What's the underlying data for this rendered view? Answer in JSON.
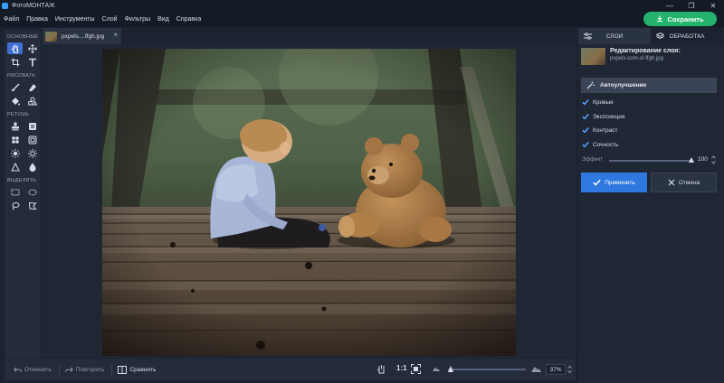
{
  "window": {
    "title": "ФотоМОНТАЖ",
    "controls": [
      "—",
      "❐",
      "✕"
    ]
  },
  "menu": [
    "Файл",
    "Правка",
    "Инструменты",
    "Слой",
    "Фильтры",
    "Вид",
    "Справка"
  ],
  "save_button": "Сохранить",
  "tools": {
    "sections": [
      {
        "title": "ОСНОВНЫЕ",
        "icons": [
          "hand-icon",
          "move-icon",
          "crop-icon",
          "text-icon"
        ]
      },
      {
        "title": "РИСОВАТЬ",
        "icons": [
          "brush-icon",
          "eraser-icon",
          "fill-icon",
          "shapes-icon"
        ]
      },
      {
        "title": "РЕТУШЬ",
        "icons": [
          "stamp-icon",
          "patch-icon",
          "heal-icon",
          "frame-icon",
          "sun-icon",
          "burn-icon",
          "sharpen-icon",
          "blur-icon"
        ]
      },
      {
        "title": "ВЫДЕЛИТЬ",
        "icons": [
          "rect-select-icon",
          "ellipse-select-icon",
          "lasso-icon",
          "polygon-lasso-icon"
        ]
      }
    ]
  },
  "doc_tab": {
    "name": "pxpels....ffgh.jpg",
    "close": "×"
  },
  "bottom": {
    "undo": "Отменить",
    "redo": "Повторить",
    "compare": "Сравнить",
    "ratio": "1:1",
    "zoom": "37%",
    "zoom_fraction": 0.03
  },
  "right_panel": {
    "tab_layers": "СЛОИ",
    "tab_processing": "ОБРАБОТКА",
    "layer_title": "Редактирование слоя:",
    "layer_file": "pxpels-com-sf-ffgh.jpg",
    "auto_title": "Автоулучшение",
    "options": [
      "Кривые",
      "Экспозиция",
      "Контраст",
      "Сочность"
    ],
    "effect_label": "Эффект",
    "effect_value": "100",
    "apply": "Применить",
    "cancel": "Отмена"
  },
  "colors": {
    "accent_green": "#23b36c",
    "accent_blue": "#2f78e0"
  }
}
